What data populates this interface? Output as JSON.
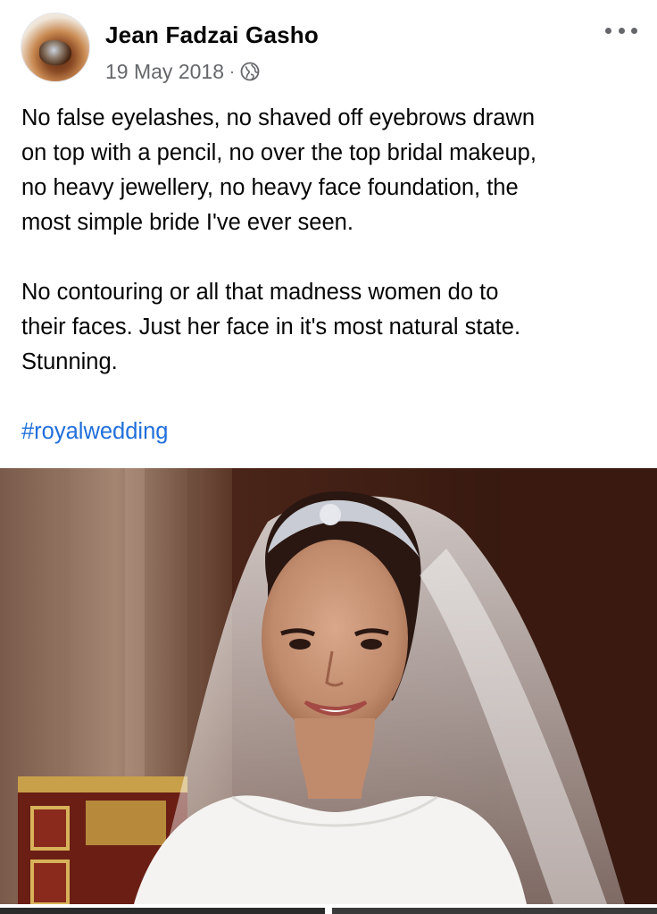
{
  "post": {
    "author": "Jean Fadzai Gasho",
    "date": "19 May 2018",
    "separator": "·",
    "privacy_icon": "globe-icon",
    "more_icon": "more-horizontal-icon",
    "paragraphs": [
      "No false eyelashes, no shaved off eyebrows drawn\non top with a pencil, no over the top bridal makeup,\nno heavy jewellery, no heavy face foundation, the\nmost simple bride I've ever seen.",
      "No contouring or all that madness women do to\ntheir faces. Just her face in it's most natural state.\nStunning."
    ],
    "hashtag": "#royalwedding"
  },
  "colors": {
    "text": "#050505",
    "secondary": "#65676b",
    "link": "#216fdb",
    "background": "#ffffff"
  }
}
